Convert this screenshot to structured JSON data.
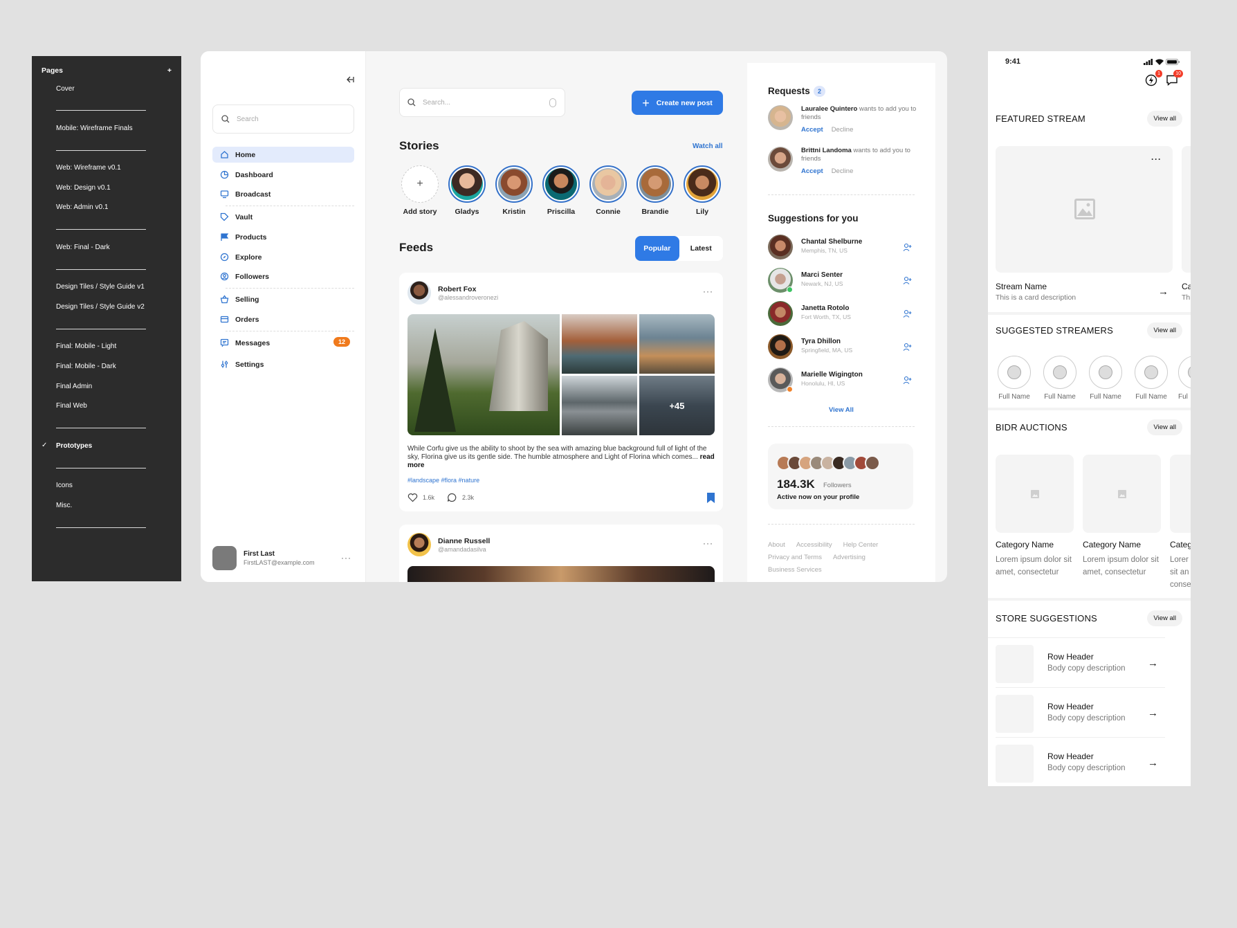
{
  "pages_panel": {
    "title": "Pages",
    "items": [
      "Cover",
      "Mobile: Wireframe Finals",
      "Web: Wireframe v0.1",
      "Web: Design v0.1",
      "Web: Admin v0.1",
      "Web: Final - Dark",
      "Design Tiles / Style Guide v1",
      "Design Tiles / Style Guide v2",
      "Final: Mobile - Light",
      "Final: Mobile - Dark",
      "Final Admin",
      "Final Web",
      "Prototypes",
      "Icons",
      "Misc."
    ],
    "selected": "Prototypes"
  },
  "nav": {
    "search_placeholder": "Search",
    "items": [
      "Home",
      "Dashboard",
      "Broadcast",
      "Vault",
      "Products",
      "Explore",
      "Followers",
      "Selling",
      "Orders",
      "Messages",
      "Settings"
    ],
    "messages_badge": "12",
    "user": {
      "name": "First Last",
      "email": "FirstLAST@example.com"
    }
  },
  "main": {
    "search_placeholder": "Search...",
    "create_button": "Create new post",
    "stories_title": "Stories",
    "watch_all": "Watch all",
    "add_story": "Add story",
    "stories": [
      "Gladys",
      "Kristin",
      "Priscilla",
      "Connie",
      "Brandie",
      "Lily"
    ],
    "feeds_title": "Feeds",
    "tabs": [
      "Popular",
      "Latest"
    ],
    "active_tab": "Popular",
    "posts": [
      {
        "name": "Robert Fox",
        "handle": "@alessandroveronezi",
        "text": "While Corfu give us the ability to shoot by the sea with amazing blue background full of light of the sky, Florina give us its gentle side. The humble atmosphere and Light of Florina which comes...",
        "read_more": "read more",
        "tags": "#landscape #flora #nature",
        "likes": "1.6k",
        "comments": "2.3k",
        "more_photos": "+45"
      },
      {
        "name": "Dianne Russell",
        "handle": "@amandadasilva"
      }
    ]
  },
  "right": {
    "requests_title": "Requests",
    "requests_count": "2",
    "requests": [
      {
        "name": "Lauralee Quintero",
        "text": "wants to add you to friends"
      },
      {
        "name": "Brittni Landoma",
        "text": "wants to add you to friends"
      }
    ],
    "accept": "Accept",
    "decline": "Decline",
    "suggestions_title": "Suggestions for you",
    "suggestions": [
      {
        "name": "Chantal Shelburne",
        "location": "Memphis, TN, US"
      },
      {
        "name": "Marci Senter",
        "location": "Newark, NJ, US"
      },
      {
        "name": "Janetta Rotolo",
        "location": "Fort Worth, TX, US"
      },
      {
        "name": "Tyra Dhillon",
        "location": "Springfield, MA, US"
      },
      {
        "name": "Marielle Wigington",
        "location": "Honolulu, HI, US"
      }
    ],
    "view_all": "View All",
    "followers_count": "184.3K",
    "followers_label": "Followers",
    "followers_sub": "Active now on your profile",
    "footer": [
      "About",
      "Accessibility",
      "Help Center",
      "Privacy and Terms",
      "Advertising",
      "Business Services"
    ]
  },
  "mobile": {
    "time": "9:41",
    "bolt_badge": "1",
    "chat_badge": "10",
    "view_all": "View all",
    "featured_title": "FEATURED STREAM",
    "stream_name": "Stream Name",
    "stream_desc": "This is a card description",
    "stream_name_peek": "Ca",
    "stream_desc_peek": "Th",
    "streamers_title": "SUGGESTED STREAMERS",
    "streamer_label": "Full Name",
    "streamer_peek": "Ful",
    "auctions_title": "BIDR AUCTIONS",
    "category_name": "Category Name",
    "category_peek": "Categ",
    "category_body": "Lorem ipsum dolor sit amet, consectetur",
    "category_body_peek": "Lorer sit an conse",
    "store_title": "STORE SUGGESTIONS",
    "row_header": "Row Header",
    "row_body": "Body copy description"
  },
  "colors": {
    "accent": "#2f7ae5",
    "badge_orange": "#f07a1c",
    "panel_dark": "#2c2c2c",
    "online_green": "#3cc463",
    "offline_orange": "#f0822a"
  }
}
